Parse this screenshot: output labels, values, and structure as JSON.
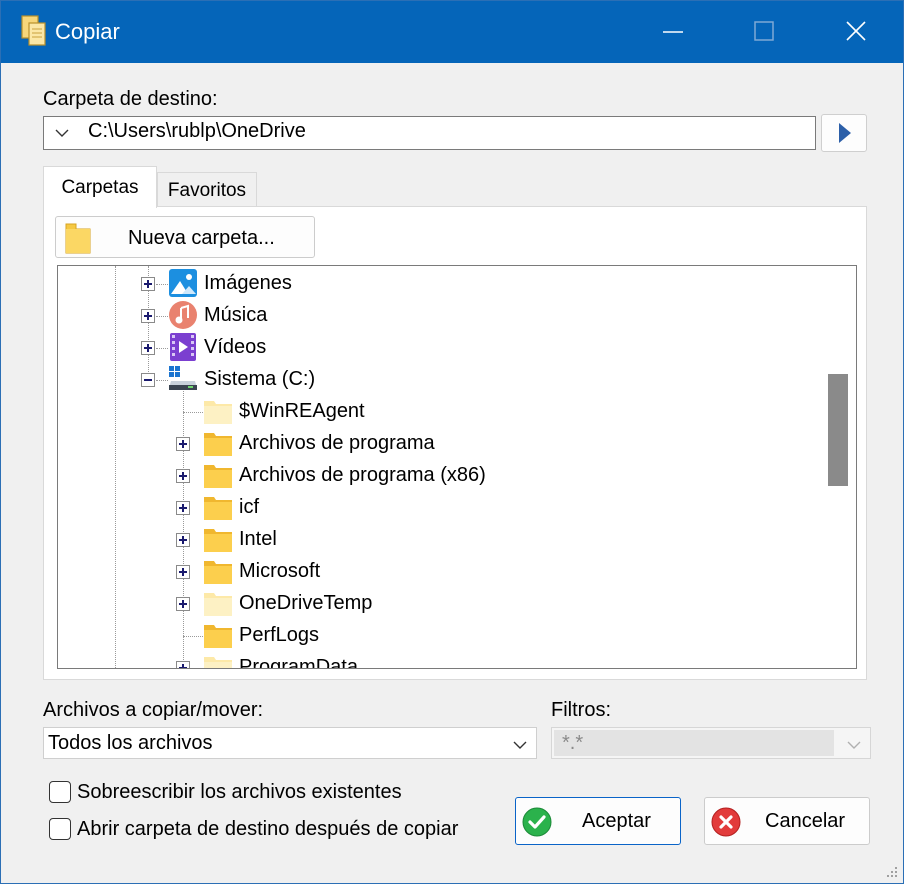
{
  "window": {
    "title": "Copiar",
    "controls": {
      "minimize": "minimize-icon",
      "maximize": "maximize-icon",
      "close": "close-icon"
    }
  },
  "destination": {
    "label": "Carpeta de destino:",
    "path": "C:\\Users\\rublp\\OneDrive",
    "go_icon": "play-arrow-icon"
  },
  "tabs": [
    {
      "label": "Carpetas",
      "active": true
    },
    {
      "label": "Favoritos",
      "active": false
    }
  ],
  "new_folder_button": "Nueva carpeta...",
  "tree": {
    "nodes": [
      {
        "label": "Imágenes",
        "icon": "pictures-icon",
        "expander": "plus",
        "level": 1
      },
      {
        "label": "Música",
        "icon": "music-icon",
        "expander": "plus",
        "level": 1
      },
      {
        "label": "Vídeos",
        "icon": "videos-icon",
        "expander": "plus",
        "level": 1
      },
      {
        "label": "Sistema (C:)",
        "icon": "drive-icon",
        "expander": "minus",
        "level": 1
      },
      {
        "label": "$WinREAgent",
        "icon": "folder-light-icon",
        "expander": "none",
        "level": 2
      },
      {
        "label": "Archivos de programa",
        "icon": "folder-icon",
        "expander": "plus",
        "level": 2
      },
      {
        "label": "Archivos de programa (x86)",
        "icon": "folder-icon",
        "expander": "plus",
        "level": 2
      },
      {
        "label": "icf",
        "icon": "folder-icon",
        "expander": "plus",
        "level": 2
      },
      {
        "label": "Intel",
        "icon": "folder-icon",
        "expander": "plus",
        "level": 2
      },
      {
        "label": "Microsoft",
        "icon": "folder-icon",
        "expander": "plus",
        "level": 2
      },
      {
        "label": "OneDriveTemp",
        "icon": "folder-light-icon",
        "expander": "plus",
        "level": 2
      },
      {
        "label": "PerfLogs",
        "icon": "folder-icon",
        "expander": "none",
        "level": 2
      },
      {
        "label": "ProgramData",
        "icon": "folder-light-icon",
        "expander": "plus",
        "level": 2
      }
    ]
  },
  "files_to_copy": {
    "label": "Archivos a copiar/mover:",
    "value": "Todos los archivos"
  },
  "filters": {
    "label": "Filtros:",
    "value": "*.*"
  },
  "options": [
    {
      "label": "Sobreescribir los archivos existentes",
      "checked": false
    },
    {
      "label": "Abrir carpeta de destino después de copiar",
      "checked": false
    }
  ],
  "buttons": {
    "ok": "Aceptar",
    "cancel": "Cancelar"
  },
  "colors": {
    "titlebar": "#0565b9",
    "accent": "#0a64c8"
  }
}
